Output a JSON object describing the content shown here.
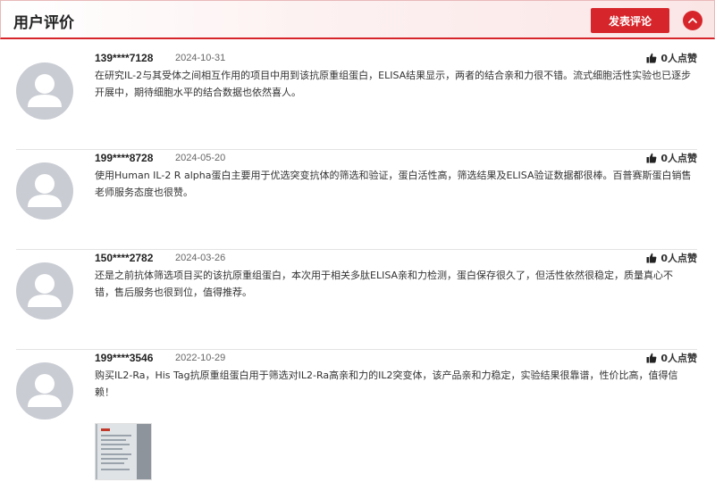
{
  "header": {
    "title": "用户评价",
    "post_button": "发表评论",
    "collapse_icon": "chevron-up-icon"
  },
  "colors": {
    "accent": "#d7262b",
    "avatar": "#c9ccd3",
    "divider": "#e3e3e3"
  },
  "reviews": [
    {
      "user": "139****7128",
      "date": "2024-10-31",
      "likes": "0人点赞",
      "content": "在研究IL-2与其受体之间相互作用的项目中用到该抗原重组蛋白，ELISA结果显示，两者的结合亲和力很不错。流式细胞活性实验也已逐步开展中，期待细胞水平的结合数据也依然喜人。"
    },
    {
      "user": "199****8728",
      "date": "2024-05-20",
      "likes": "0人点赞",
      "content": "使用Human IL-2 R alpha蛋白主要用于优选突变抗体的筛选和验证，蛋白活性高，筛选结果及ELISA验证数据都很棒。百普赛斯蛋白销售老师服务态度也很赞。"
    },
    {
      "user": "150****2782",
      "date": "2024-03-26",
      "likes": "0人点赞",
      "content": "还是之前抗体筛选项目买的该抗原重组蛋白，本次用于相关多肽ELISA亲和力检测，蛋白保存很久了，但活性依然很稳定，质量真心不错，售后服务也很到位，值得推荐。"
    },
    {
      "user": "199****3546",
      "date": "2022-10-29",
      "likes": "0人点赞",
      "content": "购买IL2-Ra，His Tag抗原重组蛋白用于筛选对IL2-Ra高亲和力的IL2突变体，该产品亲和力稳定，实验结果很靠谱，性价比高，值得信赖！"
    }
  ]
}
